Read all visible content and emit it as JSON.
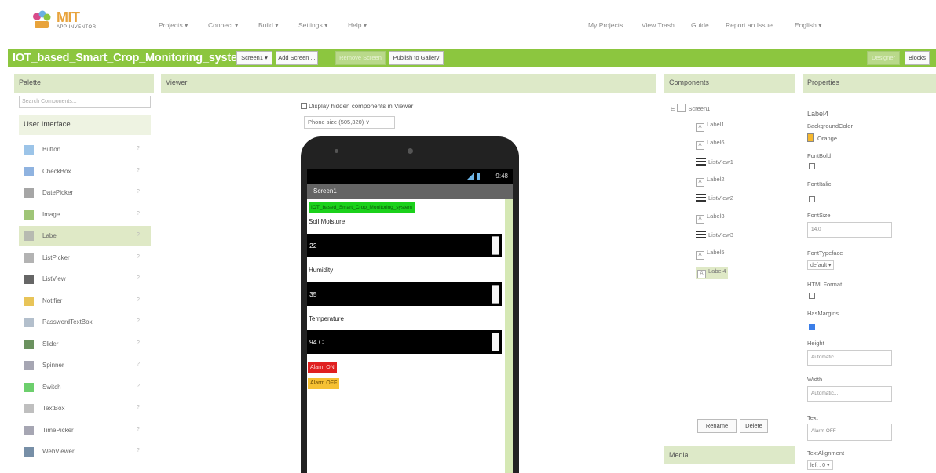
{
  "colors": {
    "accent_green": "#8cc63f",
    "header_tint": "#dde9c8",
    "selected_tint": "#dfe9c6"
  },
  "header": {
    "logo_text": "MIT",
    "logo_sub": "APP INVENTOR",
    "menu_left": [
      "Projects ▾",
      "Connect ▾",
      "Build ▾",
      "Settings ▾",
      "Help ▾"
    ],
    "menu_right": [
      "My Projects",
      "View Trash",
      "Guide",
      "Report an Issue",
      "English ▾"
    ]
  },
  "project_bar": {
    "title": "IOT_based_Smart_Crop_Monitoring_system",
    "screen_select": "Screen1 ▾",
    "add_screen": "Add Screen ...",
    "remove_screen": "Remove Screen",
    "publish": "Publish to Gallery",
    "designer": "Designer",
    "blocks": "Blocks"
  },
  "palette": {
    "header": "Palette",
    "search_placeholder": "Search Components...",
    "section": "User Interface",
    "items": [
      {
        "label": "Button",
        "icon": "button-icon"
      },
      {
        "label": "CheckBox",
        "icon": "checkbox-icon"
      },
      {
        "label": "DatePicker",
        "icon": "datepicker-icon"
      },
      {
        "label": "Image",
        "icon": "image-icon"
      },
      {
        "label": "Label",
        "icon": "label-icon"
      },
      {
        "label": "ListPicker",
        "icon": "listpicker-icon"
      },
      {
        "label": "ListView",
        "icon": "listview-icon"
      },
      {
        "label": "Notifier",
        "icon": "notifier-icon"
      },
      {
        "label": "PasswordTextBox",
        "icon": "password-icon"
      },
      {
        "label": "Slider",
        "icon": "slider-icon"
      },
      {
        "label": "Spinner",
        "icon": "spinner-icon"
      },
      {
        "label": "Switch",
        "icon": "switch-icon"
      },
      {
        "label": "TextBox",
        "icon": "textbox-icon"
      },
      {
        "label": "TimePicker",
        "icon": "timepicker-icon"
      },
      {
        "label": "WebViewer",
        "icon": "webviewer-icon"
      }
    ],
    "help_glyph": "?"
  },
  "viewer": {
    "header": "Viewer",
    "hidden_checkbox_label": "Display hidden components in Viewer",
    "phone_size": "Phone size (505,320) ∨",
    "status_time": "9:48",
    "screen_title": "Screen1",
    "app_title_label": "IOT_based_Smart_Crop_Monitoring_system",
    "soil_label": "Soil Moisture",
    "soil_value": "22",
    "humidity_label": "Humidity",
    "humidity_value": "35",
    "temperature_label": "Temperature",
    "temperature_value": "94 C",
    "alarm_on": "Alarm ON",
    "alarm_off": "Alarm OFF"
  },
  "components": {
    "header": "Components",
    "root": "Screen1",
    "items": [
      "Label1",
      "Label6",
      "ListView1",
      "Label2",
      "ListView2",
      "Label3",
      "ListView3",
      "Label5",
      "Label4"
    ],
    "rename": "Rename",
    "delete": "Delete",
    "media_header": "Media"
  },
  "properties": {
    "header": "Properties",
    "component": "Label4",
    "background_color_label": "BackgroundColor",
    "background_color_value": "Orange",
    "fontbold_label": "FontBold",
    "fontitalic_label": "FontItalic",
    "fontsize_label": "FontSize",
    "fontsize_value": "14.0",
    "fonttypeface_label": "FontTypeface",
    "fonttypeface_value": "default ▾",
    "htmlformat_label": "HTMLFormat",
    "hasmargins_label": "HasMargins",
    "height_label": "Height",
    "height_value": "Automatic...",
    "width_label": "Width",
    "width_value": "Automatic...",
    "text_label": "Text",
    "text_value": "Alarm OFF",
    "textalignment_label": "TextAlignment",
    "textalignment_value": "left : 0 ▾"
  }
}
